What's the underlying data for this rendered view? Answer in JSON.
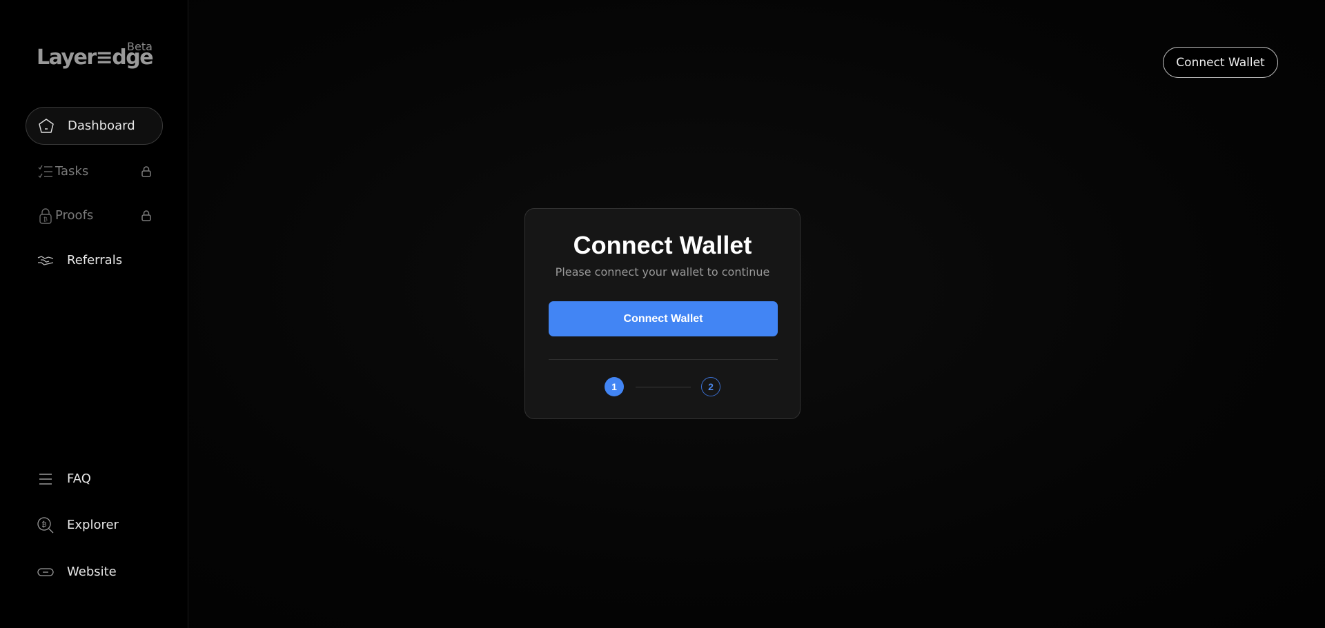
{
  "brand": {
    "logo_text": "Layer≡dge",
    "badge": "Beta"
  },
  "sidebar": {
    "items": [
      {
        "label": "Dashboard",
        "icon": "home-icon",
        "active": true,
        "locked": false
      },
      {
        "label": "Tasks",
        "icon": "checklist-icon",
        "active": false,
        "locked": true
      },
      {
        "label": "Proofs",
        "icon": "bitcoin-lock-icon",
        "active": false,
        "locked": true
      },
      {
        "label": "Referrals",
        "icon": "handshake-icon",
        "active": false,
        "locked": false
      }
    ],
    "bottom_items": [
      {
        "label": "FAQ",
        "icon": "menu-lines-icon"
      },
      {
        "label": "Explorer",
        "icon": "bitcoin-search-icon"
      },
      {
        "label": "Website",
        "icon": "link-icon"
      }
    ]
  },
  "header": {
    "connect_wallet_label": "Connect Wallet"
  },
  "modal": {
    "title": "Connect Wallet",
    "subtitle": "Please connect your wallet to continue",
    "button_label": "Connect Wallet",
    "steps": [
      "1",
      "2"
    ],
    "current_step": 1
  },
  "colors": {
    "accent": "#4285f4",
    "background": "#000000",
    "card": "#161616"
  }
}
